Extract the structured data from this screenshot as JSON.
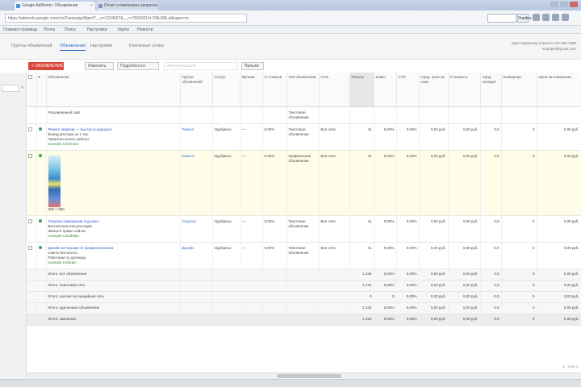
{
  "browser": {
    "tabs": [
      {
        "label": "Google AdWords: Объявления",
        "icon_color": "#4a90d9"
      },
      {
        "label": "Отчет о поисковых запросах",
        "icon_color": "#8a8fbf"
      }
    ],
    "url": "https://adwords.google.com/cm/CampaignMgmt?__u=1234567&__c=7654321#r.ONLINE.di&app=cm",
    "search_button": "Yandex"
  },
  "bookmarks": [
    "Главная страница",
    "Почта",
    "Поиск",
    "Настройки",
    "Карты",
    "Новости"
  ],
  "app": {
    "tabs": [
      "Группы объявлений",
      "Объявления",
      "Настройки",
      "Ключевые слова"
    ],
    "active_tab": 1,
    "account": [
      "Идентификатор клиента 123-456-7890",
      "example@gmail.com"
    ]
  },
  "toolbar": {
    "new_ad": "+ ОБЪЯВЛЕНИЕ",
    "edit": "Изменить",
    "details": "Подробности",
    "automate": "Автоматизация",
    "labels": "Ярлыки"
  },
  "table": {
    "columns": [
      "",
      "●",
      "Объявление",
      "Группа объявлений",
      "Статус",
      "Ярлыки",
      "% показов",
      "Тип объявления",
      "Сеть",
      "Показы",
      "Клики",
      "CTR",
      "Сред. цена за клик",
      "Стоимость",
      "Сред. позиция",
      "Конверсии",
      "Цена за конверсию"
    ],
    "sorted_column": 9,
    "rows": [
      {
        "ad": [
          "",
          "",
          "Расширенный сайт"
        ],
        "group": "",
        "status": "",
        "label": "",
        "share": "",
        "type": "Текстовое объявление",
        "net": "",
        "vals": [
          "",
          "",
          "",
          "",
          "",
          "",
          "",
          ""
        ],
        "partial": true
      },
      {
        "ad": [
          "Ремонт квартир — быстро и недорого",
          "Выезд мастера за 1 час.",
          "Гарантия на все работы.",
          "example.ru/remont"
        ],
        "group": "Ремонт",
        "status": "Одобрено",
        "label": "—",
        "share": "0,00%",
        "type": "Текстовое объявление",
        "net": "Все сети",
        "vals": [
          "41",
          "0,00%",
          "0,00%",
          "0,00 руб.",
          "0,00 руб.",
          "0,0",
          "0",
          "0,00 руб."
        ],
        "dot": "#2fa84f"
      },
      {
        "ad": [
          "",
          "",
          "300 × 250"
        ],
        "group": "Ремонт",
        "status": "Одобрено",
        "label": "—",
        "share": "0,00%",
        "type": "Графическое объявление",
        "net": "Все сети",
        "vals": [
          "41",
          "0,00%",
          "0,00%",
          "0,00 руб.",
          "0,00 руб.",
          "0,0",
          "0",
          "0,00 руб."
        ],
        "dot": "#2fa84f",
        "image": true
      },
      {
        "ad": [
          "Отделка помещений под ключ",
          "Бесплатная консультация.",
          "Звоните прямо сейчас.",
          "example.ru/otdelka"
        ],
        "group": "Отделка",
        "status": "Одобрено",
        "label": "—",
        "share": "0,00%",
        "type": "Текстовое объявление",
        "net": "Все сети",
        "vals": [
          "41",
          "0,00%",
          "0,00%",
          "0,00 руб.",
          "0,00 руб.",
          "0,0",
          "0",
          "0,00 руб."
        ],
        "dot": "#2fa84f"
      },
      {
        "ad": [
          "Дизайн интерьера от профессионалов",
          "Смета бесплатно.",
          "Работаем по договору.",
          "example.ru/dizain"
        ],
        "group": "Дизайн",
        "status": "Одобрено",
        "label": "—",
        "share": "0,00%",
        "type": "Текстовое объявление",
        "net": "Все сети",
        "vals": [
          "41",
          "0,00%",
          "0,00%",
          "0,00 руб.",
          "0,00 руб.",
          "0,0",
          "0",
          "0,00 руб."
        ],
        "dot": "#2fa84f"
      }
    ],
    "totals": [
      {
        "label": "Итого: все объявления",
        "vals": [
          "1 234",
          "0,00%",
          "0,00%",
          "0,00 руб.",
          "0,00 руб.",
          "0,0",
          "0",
          "0,00 руб."
        ]
      },
      {
        "label": "Итого: поисковая сеть",
        "vals": [
          "1 234",
          "0,00%",
          "0,00%",
          "0,00 руб.",
          "0,00 руб.",
          "0,0",
          "0",
          "0,00 руб."
        ]
      },
      {
        "label": "Итого: контекстно-медийная сеть",
        "vals": [
          "0",
          "0",
          "0,00%",
          "0,00 руб.",
          "0,00 руб.",
          "0,0",
          "0",
          "0,00 руб."
        ]
      },
      {
        "label": "Итого: удаленные объявления",
        "vals": [
          "1 234",
          "0,00%",
          "0,00%",
          "0,00 руб.",
          "0,00 руб.",
          "0,0",
          "0",
          "0,00 руб."
        ]
      },
      {
        "label": "Итого: кампания",
        "vals": [
          "1 234",
          "0,00%",
          "0,00%",
          "0,00 руб.",
          "0,00 руб.",
          "0,0",
          "0",
          "0,00 руб."
        ],
        "final": true
      }
    ],
    "pager": "1 - 4 из 4"
  }
}
